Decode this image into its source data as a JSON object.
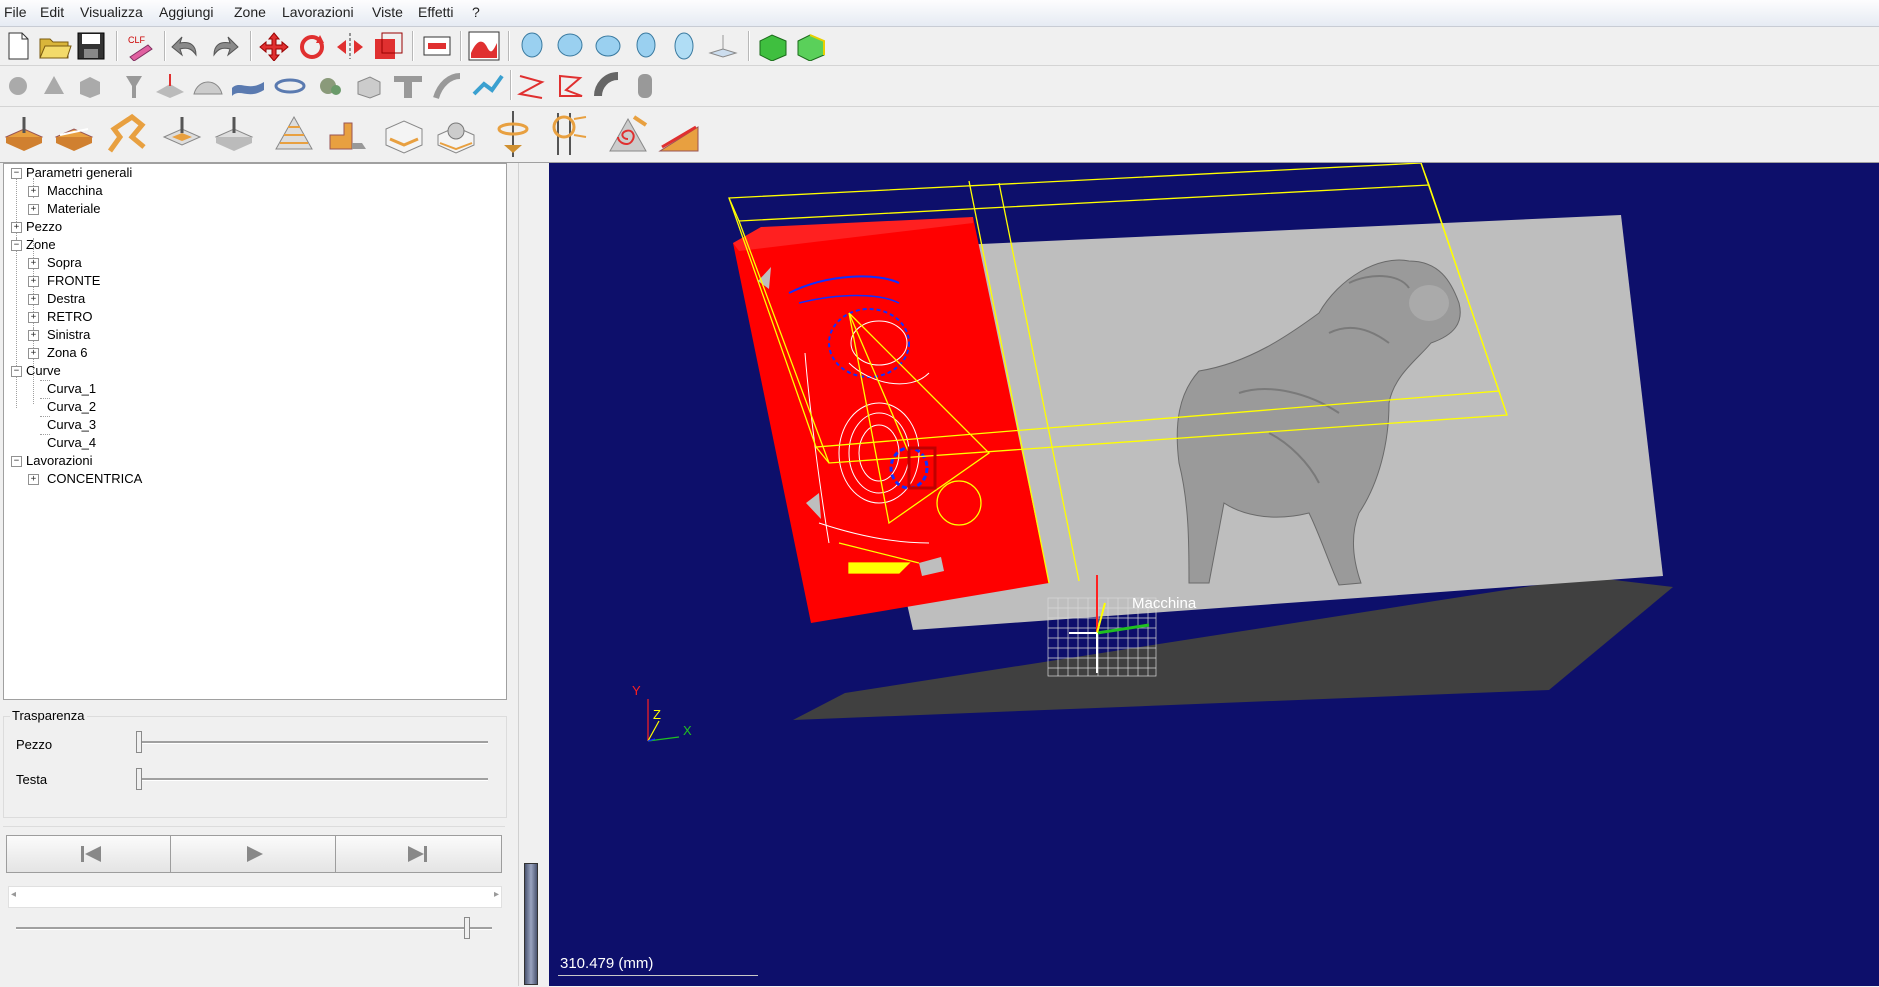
{
  "menu": [
    "File",
    "Edit",
    "Visualizza",
    "Aggiungi",
    "Zone",
    "Lavorazioni",
    "Viste",
    "Effetti",
    "?"
  ],
  "tree": {
    "parametri": "Parametri generali",
    "macchina": "Macchina",
    "materiale": "Materiale",
    "pezzo": "Pezzo",
    "zone": "Zone",
    "sopra": "Sopra",
    "fronte": "FRONTE",
    "destra": "Destra",
    "retro": "RETRO",
    "sinistra": "Sinistra",
    "zona6": "Zona 6",
    "curve": "Curve",
    "curva1": "Curva_1",
    "curva2": "Curva_2",
    "curva3": "Curva_3",
    "curva4": "Curva_4",
    "lavorazioni": "Lavorazioni",
    "concentrica": "CONCENTRICA"
  },
  "transparency": {
    "title": "Trasparenza",
    "pezzo": "Pezzo",
    "testa": "Testa",
    "pezzo_value": 0,
    "testa_value": 0
  },
  "viewport": {
    "machine_label": "Macchina",
    "scale": "310.479 (mm)",
    "axis_y": "Y",
    "axis_z": "Z",
    "axis_x": "X"
  },
  "colors": {
    "viewport_bg": "#0d0f6b",
    "stock": "#ff0000",
    "bbox": "#ffff00",
    "table": "#bebebe",
    "model": "#9a9a9a"
  },
  "icons": [
    "new-file-icon",
    "open-folder-icon",
    "save-icon",
    "cnc-icon",
    "undo-icon",
    "redo-icon",
    "move-icon",
    "rotate-icon",
    "mirror-icon",
    "scale-icon",
    "zone-icon",
    "surface-icon",
    "head-front-icon",
    "head-side-icon",
    "head-top-icon",
    "head-back-icon",
    "head-bottom-icon",
    "axis-icon",
    "box-green-icon",
    "box-yellow-icon"
  ]
}
